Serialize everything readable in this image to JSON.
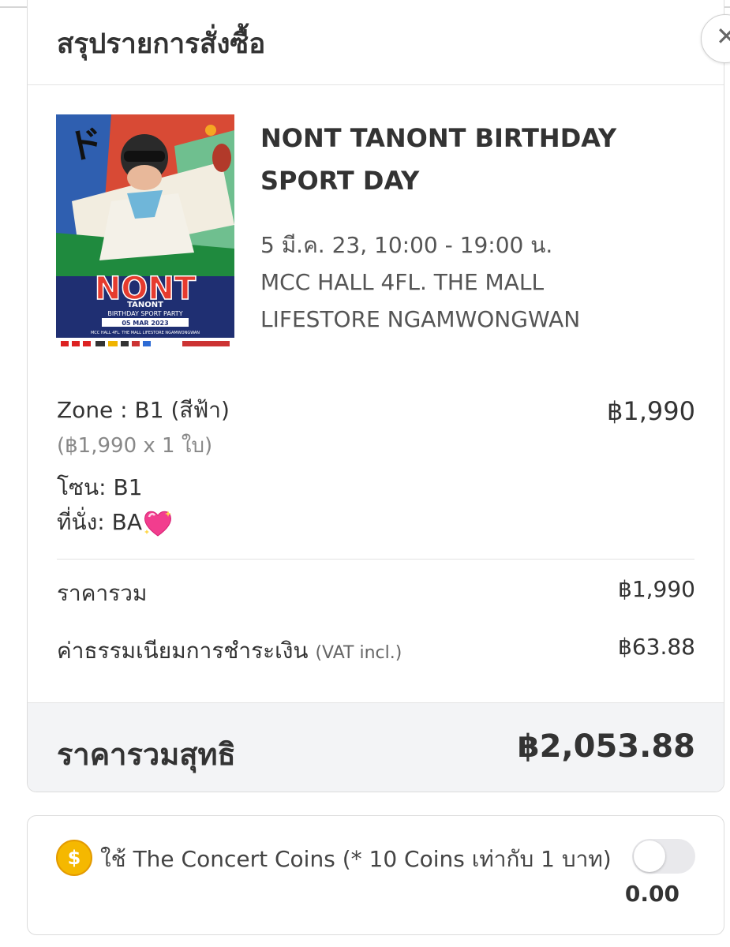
{
  "header": {
    "title": "สรุปรายการสั่งซื้อ",
    "close_label": "✕"
  },
  "event": {
    "title_line1": "NONT TANONT BIRTHDAY",
    "title_line2": "SPORT DAY",
    "datetime": "5 มี.ค. 23, 10:00 - 19:00 น.",
    "venue_line1": "MCC HALL 4FL. THE MALL",
    "venue_line2": "LIFESTORE NGAMWONGWAN"
  },
  "poster": {
    "main_text": "NONT",
    "sub_text": "TANONT",
    "tagline": "BIRTHDAY SPORT PARTY",
    "date": "05 MAR 2023",
    "venue": "MCC HALL 4FL. THE MALL LIFESTORE NGAMWONGWAN"
  },
  "ticket": {
    "zone_label": "Zone : B1 (สีฟ้า)",
    "unit_detail": "(฿1,990 x 1 ใบ)",
    "price": "฿1,990",
    "zone_line": "โซน: B1",
    "seat_line": "ที่นั่ง: BA"
  },
  "summary": {
    "subtotal_label": "ราคารวม",
    "subtotal_value": "฿1,990",
    "fee_label": "ค่าธรรมเนียมการชำระเงิน",
    "fee_note": "(VAT incl.)",
    "fee_value": "฿63.88",
    "total_label": "ราคารวมสุทธิ",
    "total_value": "฿2,053.88"
  },
  "coins": {
    "icon": "coin-icon",
    "symbol": "$",
    "label": "ใช้ The Concert Coins (* 10 Coins เท่ากับ 1 บาท)",
    "amount": "0.00",
    "enabled": false
  },
  "colors": {
    "poster_red": "#d84a35",
    "poster_navy": "#1f2f72",
    "coin_gold": "#f5b800",
    "total_bg": "#f3f4f6"
  }
}
